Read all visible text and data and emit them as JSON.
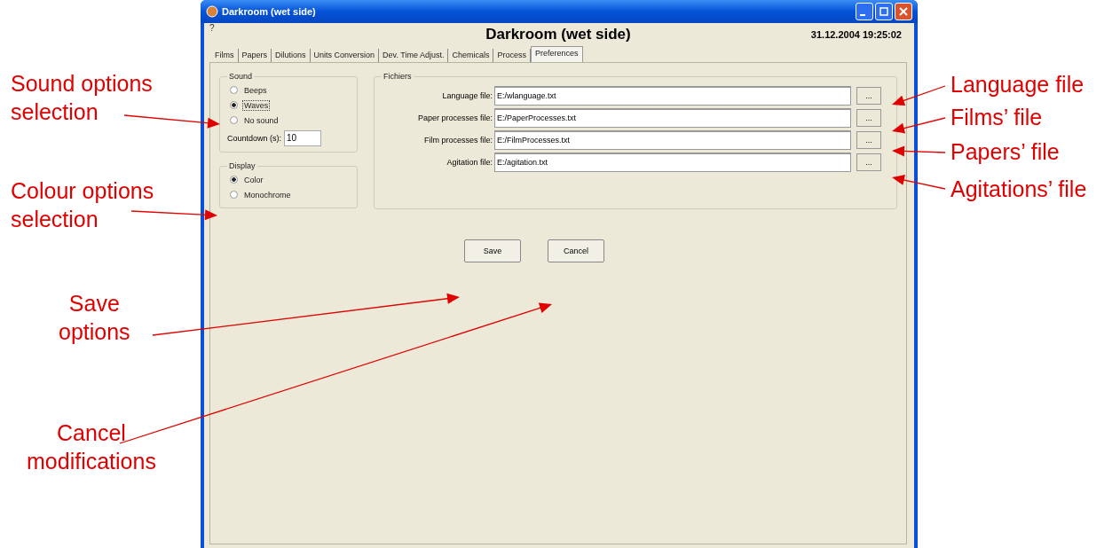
{
  "window": {
    "title": "Darkroom (wet side)",
    "help": "?",
    "heading": "Darkroom (wet side)",
    "datetime": "31.12.2004 19:25:02"
  },
  "tabs": [
    {
      "label": "Films",
      "selected": false
    },
    {
      "label": "Papers",
      "selected": false
    },
    {
      "label": "Dilutions",
      "selected": false
    },
    {
      "label": "Units Conversion",
      "selected": false
    },
    {
      "label": "Dev. Time Adjust.",
      "selected": false
    },
    {
      "label": "Chemicals",
      "selected": false
    },
    {
      "label": "Process",
      "selected": false
    },
    {
      "label": "Preferences",
      "selected": true
    }
  ],
  "sound": {
    "title": "Sound",
    "options": [
      {
        "label": "Beeps",
        "selected": false
      },
      {
        "label": "Waves",
        "selected": true
      },
      {
        "label": "No sound",
        "selected": false
      }
    ],
    "countdown_label": "Countdown (s):",
    "countdown_value": "10"
  },
  "display": {
    "title": "Display",
    "options": [
      {
        "label": "Color",
        "selected": true
      },
      {
        "label": "Monochrome",
        "selected": false
      }
    ]
  },
  "files": {
    "title": "Fichiers",
    "rows": [
      {
        "label": "Language file:",
        "value": "E:/wlanguage.txt",
        "browse": "..."
      },
      {
        "label": "Paper processes file:",
        "value": "E:/PaperProcesses.txt",
        "browse": "..."
      },
      {
        "label": "Film processes file:",
        "value": "E:/FilmProcesses.txt",
        "browse": "..."
      },
      {
        "label": "Agitation file:",
        "value": "E:/agitation.txt",
        "browse": "..."
      }
    ]
  },
  "buttons": [
    "Save",
    "Cancel"
  ],
  "annotations": [
    {
      "text": "Sound options\nselection"
    },
    {
      "text": "Colour options\nselection"
    },
    {
      "text": "Save\noptions"
    },
    {
      "text": "Cancel\nmodifications"
    },
    {
      "text": "Language file"
    },
    {
      "text": "Films’ file"
    },
    {
      "text": "Papers’ file"
    },
    {
      "text": "Agitations’ file"
    }
  ]
}
